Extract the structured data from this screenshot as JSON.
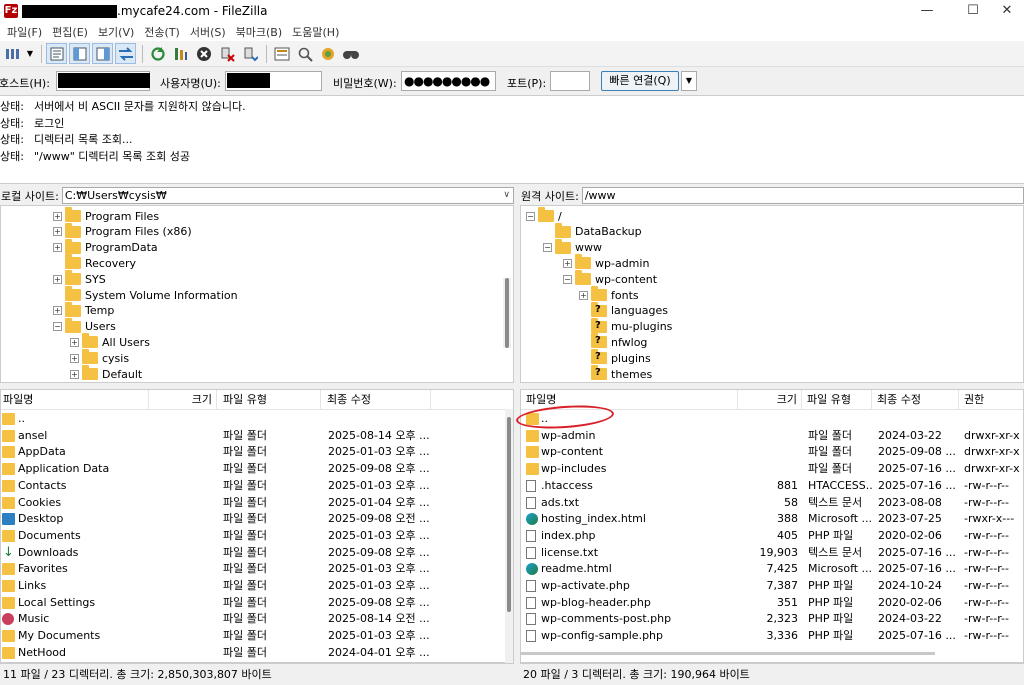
{
  "window": {
    "title_suffix": ".mycafe24.com - FileZilla",
    "app_icon_text": "Fz",
    "controls": {
      "minimize": "—",
      "maximize": "☐",
      "close": "✕"
    }
  },
  "menu": [
    "파일(F)",
    "편집(E)",
    "보기(V)",
    "전송(T)",
    "서버(S)",
    "북마크(B)",
    "도움말(H)"
  ],
  "quickconnect": {
    "host_label": "호스트(H):",
    "user_label": "사용자명(U):",
    "pass_label": "비밀번호(W):",
    "pass_value": "●●●●●●●●●",
    "port_label": "포트(P):",
    "port_value": "",
    "connect_button": "빠른 연결(Q)",
    "dropdown": "▼"
  },
  "log": [
    {
      "key": "상태:",
      "msg": "서버에서 비 ASCII 문자를 지원하지 않습니다."
    },
    {
      "key": "상태:",
      "msg": "로그인"
    },
    {
      "key": "상태:",
      "msg": "디렉터리 목록 조회..."
    },
    {
      "key": "상태:",
      "msg": "\"/www\" 디렉터리 목록 조회 성공"
    }
  ],
  "local": {
    "site_label": "로컬 사이트:",
    "path": "C:₩Users₩cysis₩",
    "tree": [
      {
        "label": "Program Files",
        "expander": "+"
      },
      {
        "label": "Program Files (x86)",
        "expander": "+"
      },
      {
        "label": "ProgramData",
        "expander": "+"
      },
      {
        "label": "Recovery",
        "expander": ""
      },
      {
        "label": "SYS",
        "expander": "+"
      },
      {
        "label": "System Volume Information",
        "expander": ""
      },
      {
        "label": "Temp",
        "expander": "+"
      },
      {
        "label": "Users",
        "expander": "−"
      },
      {
        "label": "All Users",
        "expander": "+"
      },
      {
        "label": "cysis",
        "expander": "+"
      },
      {
        "label": "Default",
        "expander": "+"
      }
    ],
    "columns": {
      "name": "파일명",
      "size": "크기",
      "type": "파일 유형",
      "modified": "최종 수정"
    },
    "files": [
      {
        "name": "..",
        "type": "",
        "modified": "",
        "icon": "folder"
      },
      {
        "name": "ansel",
        "type": "파일 폴더",
        "modified": "2025-08-14 오후 ...",
        "icon": "folder"
      },
      {
        "name": "AppData",
        "type": "파일 폴더",
        "modified": "2025-01-03 오후 ...",
        "icon": "folder"
      },
      {
        "name": "Application Data",
        "type": "파일 폴더",
        "modified": "2025-09-08 오후 ...",
        "icon": "folder"
      },
      {
        "name": "Contacts",
        "type": "파일 폴더",
        "modified": "2025-01-03 오후 ...",
        "icon": "folder"
      },
      {
        "name": "Cookies",
        "type": "파일 폴더",
        "modified": "2025-01-04 오후 ...",
        "icon": "folder"
      },
      {
        "name": "Desktop",
        "type": "파일 폴더",
        "modified": "2025-09-08 오전 ...",
        "icon": "desktop"
      },
      {
        "name": "Documents",
        "type": "파일 폴더",
        "modified": "2025-01-03 오후 ...",
        "icon": "folder"
      },
      {
        "name": "Downloads",
        "type": "파일 폴더",
        "modified": "2025-09-08 오후 ...",
        "icon": "download"
      },
      {
        "name": "Favorites",
        "type": "파일 폴더",
        "modified": "2025-01-03 오후 ...",
        "icon": "folder"
      },
      {
        "name": "Links",
        "type": "파일 폴더",
        "modified": "2025-01-03 오후 ...",
        "icon": "folder"
      },
      {
        "name": "Local Settings",
        "type": "파일 폴더",
        "modified": "2025-09-08 오후 ...",
        "icon": "folder"
      },
      {
        "name": "Music",
        "type": "파일 폴더",
        "modified": "2025-08-14 오전 ...",
        "icon": "music"
      },
      {
        "name": "My Documents",
        "type": "파일 폴더",
        "modified": "2025-01-03 오후 ...",
        "icon": "folder"
      },
      {
        "name": "NetHood",
        "type": "파일 폴더",
        "modified": "2024-04-01 오후 ...",
        "icon": "folder"
      }
    ],
    "status": "11 파일 / 23 디렉터리. 총 크기: 2,850,303,807 바이트"
  },
  "remote": {
    "site_label": "원격 사이트:",
    "path": "/www",
    "tree": [
      {
        "label": "/",
        "expander": "−"
      },
      {
        "label": "DataBackup",
        "expander": ""
      },
      {
        "label": "www",
        "expander": "−"
      },
      {
        "label": "wp-admin",
        "expander": "+"
      },
      {
        "label": "wp-content",
        "expander": "−"
      },
      {
        "label": "fonts",
        "expander": "+"
      },
      {
        "label": "languages",
        "expander": ""
      },
      {
        "label": "mu-plugins",
        "expander": ""
      },
      {
        "label": "nfwlog",
        "expander": ""
      },
      {
        "label": "plugins",
        "expander": ""
      },
      {
        "label": "themes",
        "expander": ""
      }
    ],
    "columns": {
      "name": "파일명",
      "size": "크기",
      "type": "파일 유형",
      "modified": "최종 수정",
      "perms": "권한"
    },
    "files": [
      {
        "name": "..",
        "size": "",
        "type": "",
        "modified": "",
        "perms": "",
        "icon": "folder"
      },
      {
        "name": "wp-admin",
        "size": "",
        "type": "파일 폴더",
        "modified": "2024-03-22",
        "perms": "drwxr-xr-x",
        "icon": "folder"
      },
      {
        "name": "wp-content",
        "size": "",
        "type": "파일 폴더",
        "modified": "2025-09-08 ...",
        "perms": "drwxr-xr-x",
        "icon": "folder"
      },
      {
        "name": "wp-includes",
        "size": "",
        "type": "파일 폴더",
        "modified": "2025-07-16 ...",
        "perms": "drwxr-xr-x",
        "icon": "folder"
      },
      {
        "name": ".htaccess",
        "size": "881",
        "type": "HTACCESS...",
        "modified": "2025-07-16 ...",
        "perms": "-rw-r--r--",
        "icon": "file"
      },
      {
        "name": "ads.txt",
        "size": "58",
        "type": "텍스트 문서",
        "modified": "2023-08-08",
        "perms": "-rw-r--r--",
        "icon": "file"
      },
      {
        "name": "hosting_index.html",
        "size": "388",
        "type": "Microsoft ...",
        "modified": "2023-07-25",
        "perms": "-rwxr-x---",
        "icon": "edge"
      },
      {
        "name": "index.php",
        "size": "405",
        "type": "PHP 파일",
        "modified": "2020-02-06",
        "perms": "-rw-r--r--",
        "icon": "file"
      },
      {
        "name": "license.txt",
        "size": "19,903",
        "type": "텍스트 문서",
        "modified": "2025-07-16 ...",
        "perms": "-rw-r--r--",
        "icon": "file"
      },
      {
        "name": "readme.html",
        "size": "7,425",
        "type": "Microsoft ...",
        "modified": "2025-07-16 ...",
        "perms": "-rw-r--r--",
        "icon": "edge"
      },
      {
        "name": "wp-activate.php",
        "size": "7,387",
        "type": "PHP 파일",
        "modified": "2024-10-24",
        "perms": "-rw-r--r--",
        "icon": "file"
      },
      {
        "name": "wp-blog-header.php",
        "size": "351",
        "type": "PHP 파일",
        "modified": "2020-02-06",
        "perms": "-rw-r--r--",
        "icon": "file"
      },
      {
        "name": "wp-comments-post.php",
        "size": "2,323",
        "type": "PHP 파일",
        "modified": "2024-03-22",
        "perms": "-rw-r--r--",
        "icon": "file"
      },
      {
        "name": "wp-config-sample.php",
        "size": "3,336",
        "type": "PHP 파일",
        "modified": "2025-07-16 ...",
        "perms": "-rw-r--r--",
        "icon": "file"
      }
    ],
    "status": "20 파일 / 3 디렉터리. 총 크기: 190,964 바이트"
  },
  "colors": {
    "annotation_circle": "#d8202a",
    "folder": "#f5c143",
    "accent": "#3c7fb1"
  }
}
